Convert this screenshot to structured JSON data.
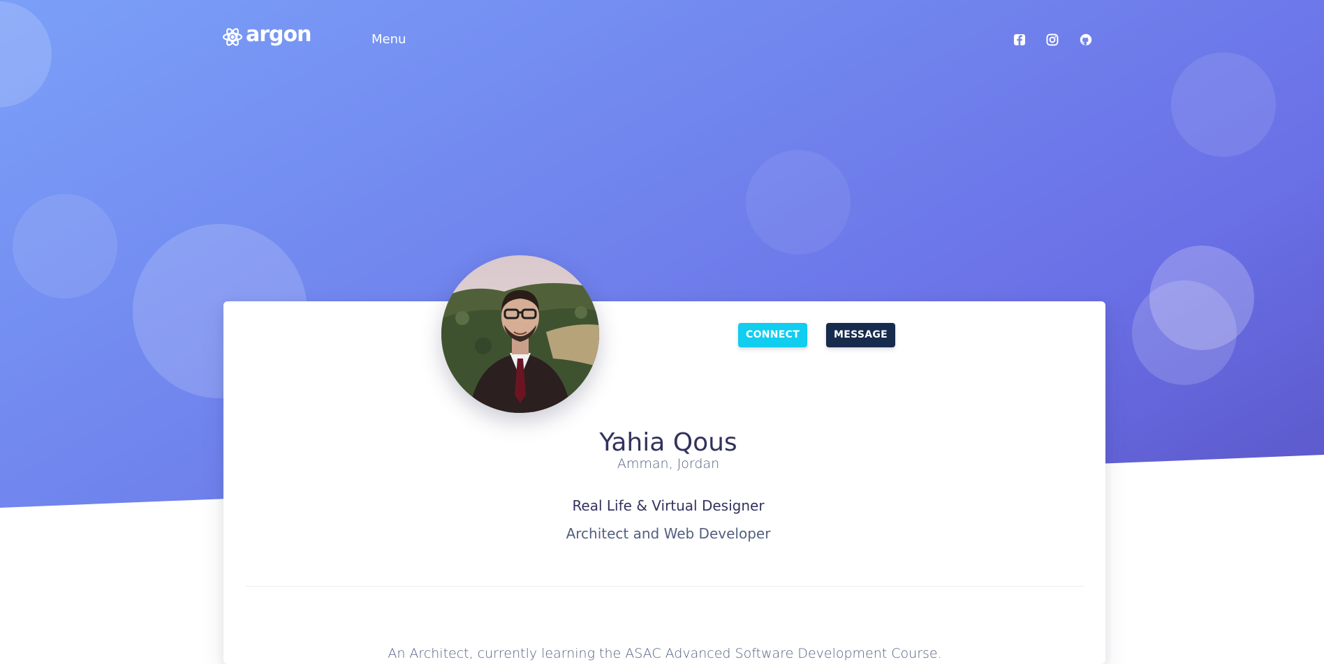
{
  "brand": {
    "name": "argon",
    "icon": "atom-icon"
  },
  "nav": {
    "menu_label": "Menu"
  },
  "social": [
    {
      "icon": "facebook-square-icon"
    },
    {
      "icon": "instagram-icon"
    },
    {
      "icon": "github-icon"
    }
  ],
  "profile": {
    "avatar": "profile-photo",
    "connect_label": "Connect",
    "message_label": "Message",
    "name": "Yahia Qous",
    "location": "Amman, Jordan",
    "title_line1": "Real Life & Virtual Designer",
    "title_line2": "Architect and Web Developer",
    "bio": "An Architect, currently learning the ASAC Advanced Software Development Course."
  },
  "colors": {
    "hero_gradient_start": "#7ba0f8",
    "hero_gradient_end": "#5a56c8",
    "connect_button": "#11cdef",
    "message_button": "#172b4d",
    "heading_text": "#32325d",
    "body_text": "#525f7f"
  }
}
